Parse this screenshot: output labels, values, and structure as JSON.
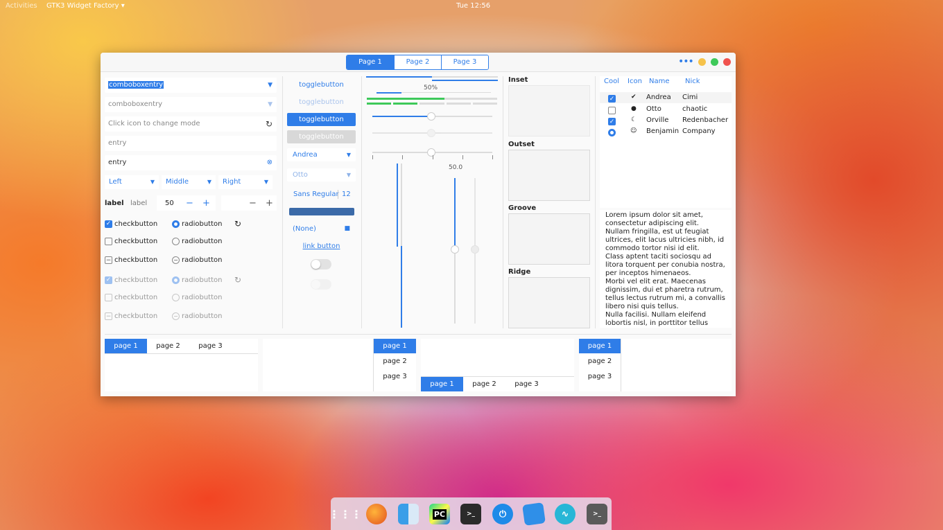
{
  "topbar": {
    "activities": "Activities",
    "app_menu": "GTK3 Widget Factory ▾",
    "clock": "Tue 12:56"
  },
  "header": {
    "stack_tabs": [
      "Page 1",
      "Page 2",
      "Page 3"
    ],
    "menu_icon": "•••"
  },
  "col1": {
    "combo1": "comboboxentry",
    "combo2": "comboboxentry",
    "mode_placeholder": "Click icon to change mode",
    "entry_placeholder": "entry",
    "entry_value": "entry",
    "aligned": [
      "Left",
      "Middle",
      "Right"
    ],
    "label1": "label",
    "label2": "label",
    "spin_value": "50",
    "checks": [
      "checkbutton",
      "checkbutton",
      "checkbutton",
      "checkbutton",
      "checkbutton",
      "checkbutton"
    ],
    "radios": [
      "radiobutton",
      "radiobutton",
      "radiobutton",
      "radiobutton",
      "radiobutton",
      "radiobutton"
    ]
  },
  "col2": {
    "toggle": [
      "togglebutton",
      "togglebutton",
      "togglebutton",
      "togglebutton"
    ],
    "combo_andrea": "Andrea",
    "combo_otto": "Otto",
    "font_name": "Sans Regular",
    "font_size": "12",
    "file_none": "(None)",
    "link": "link button"
  },
  "col3": {
    "progress_label": "50%",
    "progress": 0.5,
    "scale_value": "50.0"
  },
  "frames": [
    "Inset",
    "Outset",
    "Groove",
    "Ridge"
  ],
  "tree": {
    "headers": [
      "Cool",
      "Icon",
      "Name",
      "Nick"
    ],
    "rows": [
      {
        "name": "Andrea",
        "nick": "Cimi"
      },
      {
        "name": "Otto",
        "nick": "chaotic"
      },
      {
        "name": "Orville",
        "nick": "Redenbacher"
      },
      {
        "name": "Benjamin",
        "nick": "Company"
      }
    ]
  },
  "textview": "Lorem ipsum dolor sit amet, consectetur adipiscing elit.\nNullam fringilla, est ut feugiat ultrices, elit lacus ultricies nibh, id commodo tortor nisi id elit.\nClass aptent taciti sociosqu ad litora torquent per conubia nostra, per inceptos himenaeos.\nMorbi vel elit erat. Maecenas dignissim, dui et pharetra rutrum, tellus lectus rutrum mi, a convallis libero nisi quis tellus.\nNulla facilisi. Nullam eleifend lobortis nisl, in porttitor tellus",
  "notebooks": {
    "tabs": [
      "page 1",
      "page 2",
      "page 3"
    ]
  },
  "colors": {
    "accent": "#2f7de8",
    "green": "#3ec95a"
  }
}
